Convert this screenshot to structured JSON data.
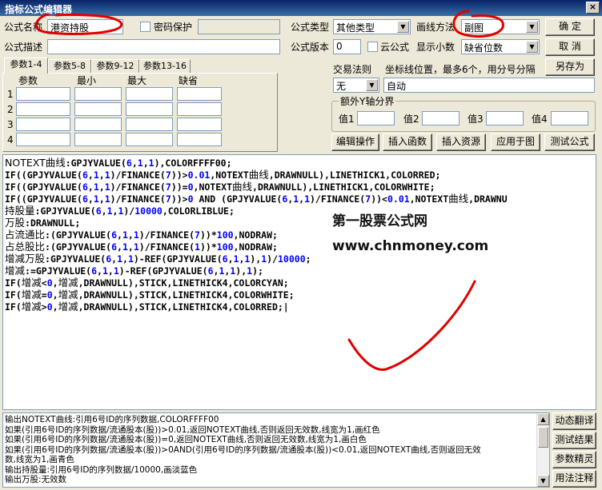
{
  "window": {
    "title": "指标公式编辑器",
    "close_label": "×"
  },
  "form": {
    "name_label": "公式名称",
    "name_value": "港资持股",
    "password_label": "密码保护",
    "desc_label": "公式描述",
    "type_label": "公式类型",
    "type_value": "其他类型",
    "draw_label": "画线方法",
    "draw_value": "副图",
    "version_label": "公式版本",
    "version_value": "0",
    "cloud_label": "云公式",
    "decimals_label": "显示小数",
    "decimals_value": "缺省位数"
  },
  "buttons": {
    "ok": "确  定",
    "cancel": "取  消",
    "save_as": "另存为",
    "edit_op": "编辑操作",
    "insert_func": "插入函数",
    "insert_res": "插入资源",
    "apply_chart": "应用于图",
    "test": "测试公式"
  },
  "tabs": [
    "参数1-4",
    "参数5-8",
    "参数9-12",
    "参数13-16"
  ],
  "params": {
    "headers": [
      "参数",
      "最小",
      "最大",
      "缺省"
    ],
    "rows": [
      "1",
      "2",
      "3",
      "4"
    ]
  },
  "trade": {
    "rule_label": "交易法则",
    "rule_value": "无",
    "coord_label": "坐标线位置，最多6个，用分号分隔",
    "coord_value": "自动"
  },
  "yaxis": {
    "title": "额外Y轴分界",
    "labels": [
      "值1",
      "值2",
      "值3",
      "值4"
    ]
  },
  "code_lines": [
    [
      [
        "NOTEXT曲线",
        "t"
      ],
      [
        ":GPJYVALUE(",
        ""
      ],
      [
        "6",
        "b"
      ],
      [
        ",",
        ""
      ],
      [
        "1",
        "b"
      ],
      [
        ",",
        ""
      ],
      [
        "1",
        "b"
      ],
      [
        "),COLORFFFF00;",
        ""
      ]
    ],
    [
      [
        "IF((GPJYVALUE(",
        ""
      ],
      [
        "6",
        "b"
      ],
      [
        ",",
        ""
      ],
      [
        "1",
        "b"
      ],
      [
        ",",
        ""
      ],
      [
        "1",
        "b"
      ],
      [
        ")/FINANCE(",
        ""
      ],
      [
        "7",
        "b"
      ],
      [
        "))>",
        ""
      ],
      [
        "0.01",
        "b"
      ],
      [
        ",NOTEXT",
        ""
      ],
      [
        "曲线",
        "t"
      ],
      [
        ",DRAWNULL),LINETHICK1,COLORRED;",
        ""
      ]
    ],
    [
      [
        "IF((GPJYVALUE(",
        ""
      ],
      [
        "6",
        "b"
      ],
      [
        ",",
        ""
      ],
      [
        "1",
        "b"
      ],
      [
        ",",
        ""
      ],
      [
        "1",
        "b"
      ],
      [
        ")/FINANCE(",
        ""
      ],
      [
        "7",
        "b"
      ],
      [
        "))=",
        ""
      ],
      [
        "0",
        "b"
      ],
      [
        ",NOTEXT",
        ""
      ],
      [
        "曲线",
        "t"
      ],
      [
        ",DRAWNULL),LINETHICK1,COLORWHITE;",
        ""
      ]
    ],
    [
      [
        "IF((GPJYVALUE(",
        ""
      ],
      [
        "6",
        "b"
      ],
      [
        ",",
        ""
      ],
      [
        "1",
        "b"
      ],
      [
        ",",
        ""
      ],
      [
        "1",
        "b"
      ],
      [
        ")/FINANCE(",
        ""
      ],
      [
        "7",
        "b"
      ],
      [
        "))>",
        ""
      ],
      [
        "0",
        "b"
      ],
      [
        " AND (GPJYVALUE(",
        ""
      ],
      [
        "6",
        "b"
      ],
      [
        ",",
        ""
      ],
      [
        "1",
        "b"
      ],
      [
        ",",
        ""
      ],
      [
        "1",
        "b"
      ],
      [
        ")/FINANCE(",
        ""
      ],
      [
        "7",
        "b"
      ],
      [
        "))<",
        ""
      ],
      [
        "0.01",
        "b"
      ],
      [
        ",NOTEXT",
        ""
      ],
      [
        "曲线",
        "t"
      ],
      [
        ",DRAWNU",
        ""
      ]
    ],
    [
      [
        "持股量",
        "t"
      ],
      [
        ":GPJYVALUE(",
        ""
      ],
      [
        "6",
        "b"
      ],
      [
        ",",
        ""
      ],
      [
        "1",
        "b"
      ],
      [
        ",",
        ""
      ],
      [
        "1",
        "b"
      ],
      [
        ")/",
        ""
      ],
      [
        "10000",
        "b"
      ],
      [
        ",COLORLIBLUE;",
        ""
      ]
    ],
    [
      [
        "万股",
        "t"
      ],
      [
        ":DRAWNULL;",
        ""
      ]
    ],
    [
      [
        "占流通比",
        "t"
      ],
      [
        ":(GPJYVALUE(",
        ""
      ],
      [
        "6",
        "b"
      ],
      [
        ",",
        ""
      ],
      [
        "1",
        "b"
      ],
      [
        ",",
        ""
      ],
      [
        "1",
        "b"
      ],
      [
        ")/FINANCE(",
        ""
      ],
      [
        "7",
        "b"
      ],
      [
        "))*",
        ""
      ],
      [
        "100",
        "b"
      ],
      [
        ",NODRAW;",
        ""
      ]
    ],
    [
      [
        "占总股比",
        "t"
      ],
      [
        ":(GPJYVALUE(",
        ""
      ],
      [
        "6",
        "b"
      ],
      [
        ",",
        ""
      ],
      [
        "1",
        "b"
      ],
      [
        ",",
        ""
      ],
      [
        "1",
        "b"
      ],
      [
        ")/FINANCE(",
        ""
      ],
      [
        "1",
        "b"
      ],
      [
        "))*",
        ""
      ],
      [
        "100",
        "b"
      ],
      [
        ",NODRAW;",
        ""
      ]
    ],
    [
      [
        "增减万股",
        "t"
      ],
      [
        ":GPJYVALUE(",
        ""
      ],
      [
        "6",
        "b"
      ],
      [
        ",",
        ""
      ],
      [
        "1",
        "b"
      ],
      [
        ",",
        ""
      ],
      [
        "1",
        "b"
      ],
      [
        ")-REF(GPJYVALUE(",
        ""
      ],
      [
        "6",
        "b"
      ],
      [
        ",",
        ""
      ],
      [
        "1",
        "b"
      ],
      [
        ",",
        ""
      ],
      [
        "1",
        "b"
      ],
      [
        "),",
        ""
      ],
      [
        "1",
        "b"
      ],
      [
        ")/",
        ""
      ],
      [
        "10000",
        "b"
      ],
      [
        ";",
        ""
      ]
    ],
    [
      [
        "增减",
        "t"
      ],
      [
        ":=GPJYVALUE(",
        ""
      ],
      [
        "6",
        "b"
      ],
      [
        ",",
        ""
      ],
      [
        "1",
        "b"
      ],
      [
        ",",
        ""
      ],
      [
        "1",
        "b"
      ],
      [
        ")-REF(GPJYVALUE(",
        ""
      ],
      [
        "6",
        "b"
      ],
      [
        ",",
        ""
      ],
      [
        "1",
        "b"
      ],
      [
        ",",
        ""
      ],
      [
        "1",
        "b"
      ],
      [
        "),",
        ""
      ],
      [
        "1",
        "b"
      ],
      [
        ");",
        ""
      ]
    ],
    [
      [
        "IF(",
        ""
      ],
      [
        "增减",
        "t"
      ],
      [
        "<",
        ""
      ],
      [
        "0",
        "b"
      ],
      [
        ",",
        ""
      ],
      [
        "增减",
        "t"
      ],
      [
        ",DRAWNULL),STICK,LINETHICK4,COLORCYAN;",
        ""
      ]
    ],
    [
      [
        "IF(",
        ""
      ],
      [
        "增减",
        "t"
      ],
      [
        "=",
        ""
      ],
      [
        "0",
        "b"
      ],
      [
        ",",
        ""
      ],
      [
        "增减",
        "t"
      ],
      [
        ",DRAWNULL),STICK,LINETHICK4,COLORWHITE;",
        ""
      ]
    ],
    [
      [
        "IF(",
        ""
      ],
      [
        "增减",
        "t"
      ],
      [
        ">",
        ""
      ],
      [
        "0",
        "b"
      ],
      [
        ",",
        ""
      ],
      [
        "增减",
        "t"
      ],
      [
        ",DRAWNULL),STICK,LINETHICK4,COLORRED;|",
        ""
      ]
    ]
  ],
  "watermark": {
    "line1": "第一股票公式网",
    "line2": "www.chnmoney.com"
  },
  "output_lines": [
    "输出NOTEXT曲线:引用6号ID的序列数据,COLORFFFF00",
    "如果(引用6号ID的序列数据/流通股本(股))>0.01,返回NOTEXT曲线,否则返回无效数,线宽为1,画红色",
    "如果(引用6号ID的序列数据/流通股本(股))=0,返回NOTEXT曲线,否则返回无效数,线宽为1,画白色",
    "如果(引用6号ID的序列数据/流通股本(股))>0AND(引用6号ID的序列数据/流通股本(股))<0.01,返回NOTEXT曲线,否则返回无效",
    "数,线宽为1,画青色",
    "输出持股量:引用6号ID的序列数据/10000,画淡蓝色",
    "输出万股:无效数"
  ],
  "side_buttons": [
    "动态翻译",
    "测试结果",
    "参数精灵",
    "用法注释"
  ],
  "colors": {
    "annotation_red": "#e00000",
    "titlebar": "#0a246a",
    "keyword_blue": "#0000ff"
  }
}
